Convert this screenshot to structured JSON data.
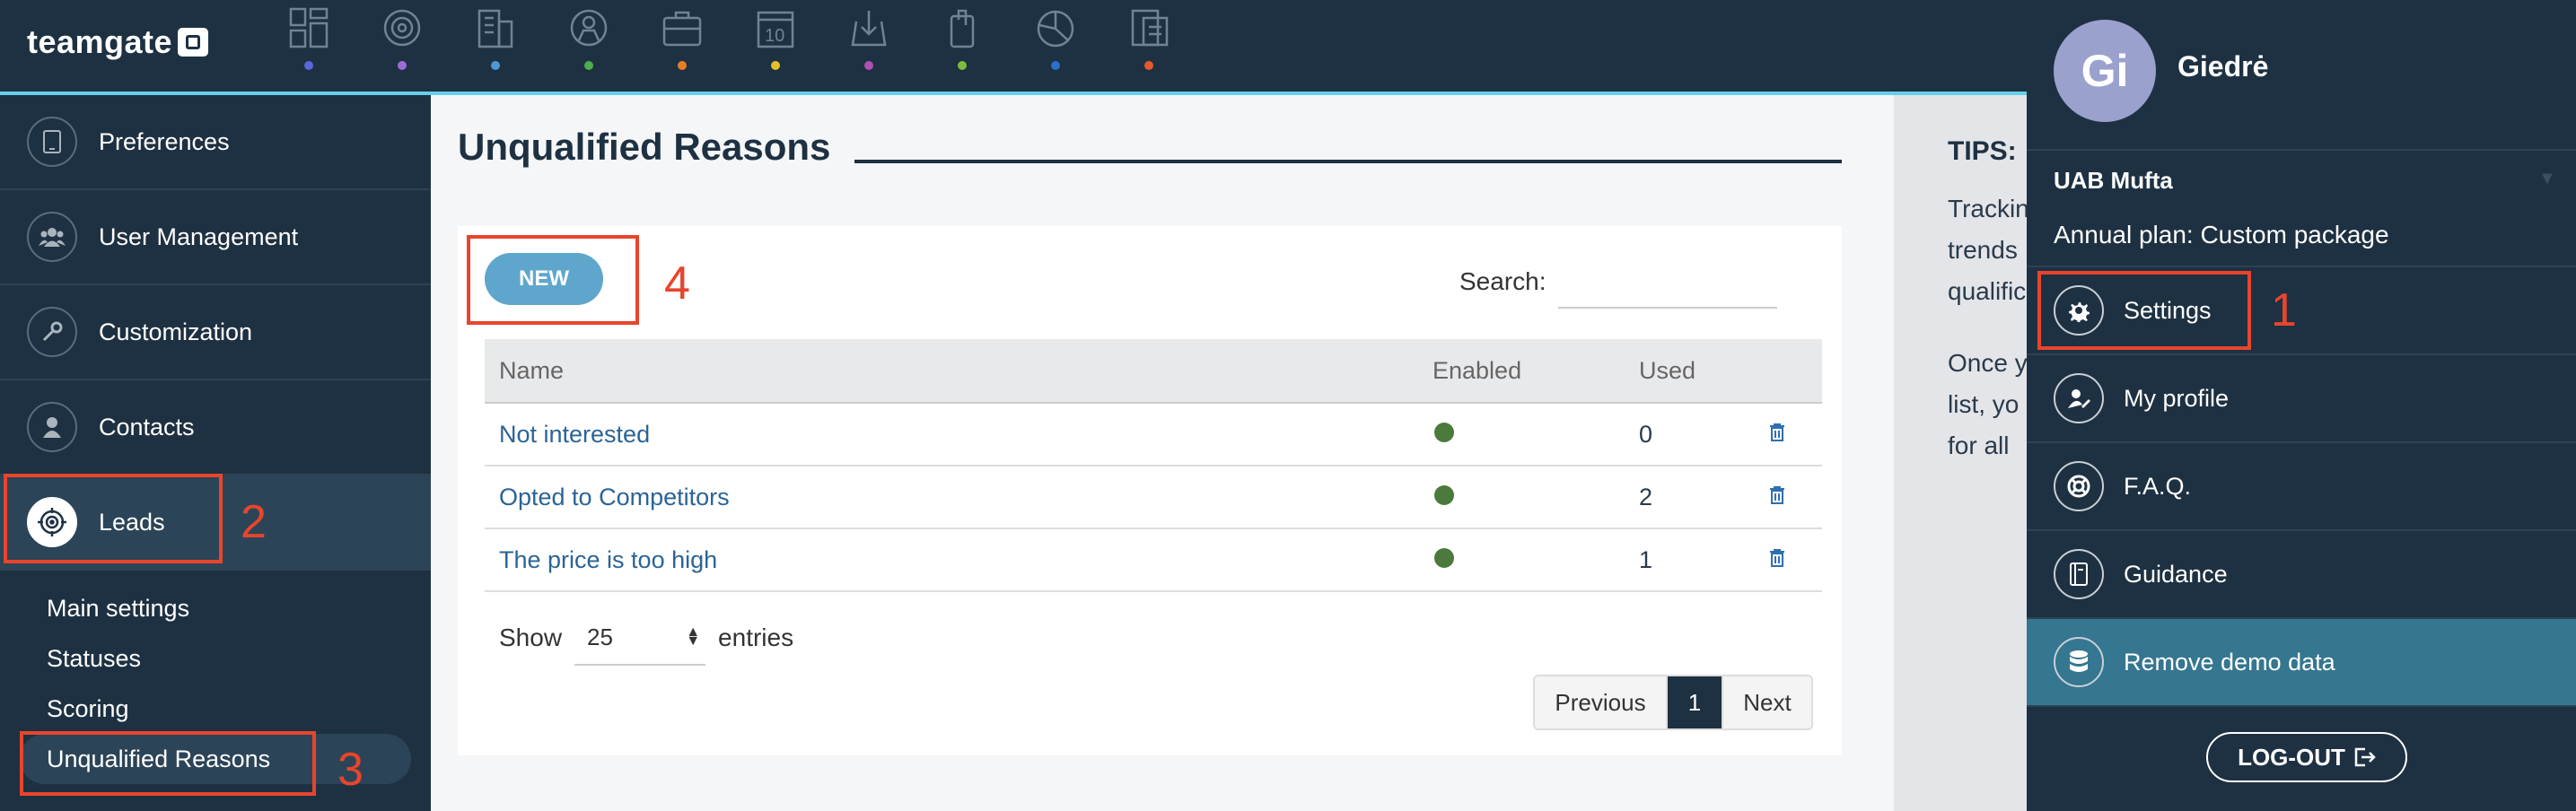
{
  "app": {
    "logo_text": "teamgate"
  },
  "topnav": {
    "items": [
      {
        "icon": "dashboard-icon",
        "dot_color": "#5a67d8"
      },
      {
        "icon": "target-icon",
        "dot_color": "#9f6ad8"
      },
      {
        "icon": "building-icon",
        "dot_color": "#4f97d6"
      },
      {
        "icon": "person-icon",
        "dot_color": "#4cae4c"
      },
      {
        "icon": "briefcase-icon",
        "dot_color": "#e67e22"
      },
      {
        "icon": "calendar-icon",
        "dot_color": "#e5c02a",
        "text": "10"
      },
      {
        "icon": "download-box-icon",
        "dot_color": "#b24fb0"
      },
      {
        "icon": "paperclip-icon",
        "dot_color": "#7cbc3a"
      },
      {
        "icon": "pie-chart-icon",
        "dot_color": "#2d6fd0"
      },
      {
        "icon": "report-icon",
        "dot_color": "#e55a2a"
      }
    ]
  },
  "sidebar": {
    "items": [
      {
        "label": "Preferences",
        "icon": "phone-icon"
      },
      {
        "label": "User Management",
        "icon": "users-icon"
      },
      {
        "label": "Customization",
        "icon": "wrench-icon"
      },
      {
        "label": "Contacts",
        "icon": "person-icon"
      },
      {
        "label": "Leads",
        "icon": "target-icon"
      }
    ],
    "sub_items": [
      {
        "label": "Main settings"
      },
      {
        "label": "Statuses"
      },
      {
        "label": "Scoring"
      },
      {
        "label": "Unqualified Reasons"
      }
    ]
  },
  "main": {
    "title": "Unqualified Reasons",
    "new_button": "NEW",
    "search_label": "Search:",
    "search_value": "",
    "table": {
      "headers": [
        "Name",
        "Enabled",
        "Used"
      ],
      "rows": [
        {
          "name": "Not interested",
          "enabled": true,
          "used": "0"
        },
        {
          "name": "Opted to Competitors",
          "enabled": true,
          "used": "2"
        },
        {
          "name": "The price is too high",
          "enabled": true,
          "used": "1"
        }
      ]
    },
    "show_label": "Show",
    "page_size": "25",
    "entries_label": "entries",
    "pagination": {
      "previous": "Previous",
      "current": "1",
      "next": "Next"
    }
  },
  "tips": {
    "title": "TIPS:",
    "text_line_1": "Trackin",
    "text_line_2": "trends",
    "text_line_3": "qualific",
    "text_line_4": "Once y",
    "text_line_5": "list, yo",
    "text_line_6": "for all"
  },
  "user_panel": {
    "avatar_initials": "Gi",
    "user_name": "Giedrė",
    "company": "UAB Mufta",
    "plan": "Annual plan: Custom package",
    "menu": [
      {
        "label": "Settings",
        "icon": "gear-icon"
      },
      {
        "label": "My profile",
        "icon": "profile-edit-icon"
      },
      {
        "label": "F.A.Q.",
        "icon": "lifebuoy-icon"
      },
      {
        "label": "Guidance",
        "icon": "guide-book-icon"
      },
      {
        "label": "Remove demo data",
        "icon": "database-icon"
      }
    ],
    "logout": "LOG-OUT"
  },
  "annotations": {
    "callout_1": "1",
    "callout_2": "2",
    "callout_3": "3",
    "callout_4": "4",
    "color": "#e8452c"
  }
}
